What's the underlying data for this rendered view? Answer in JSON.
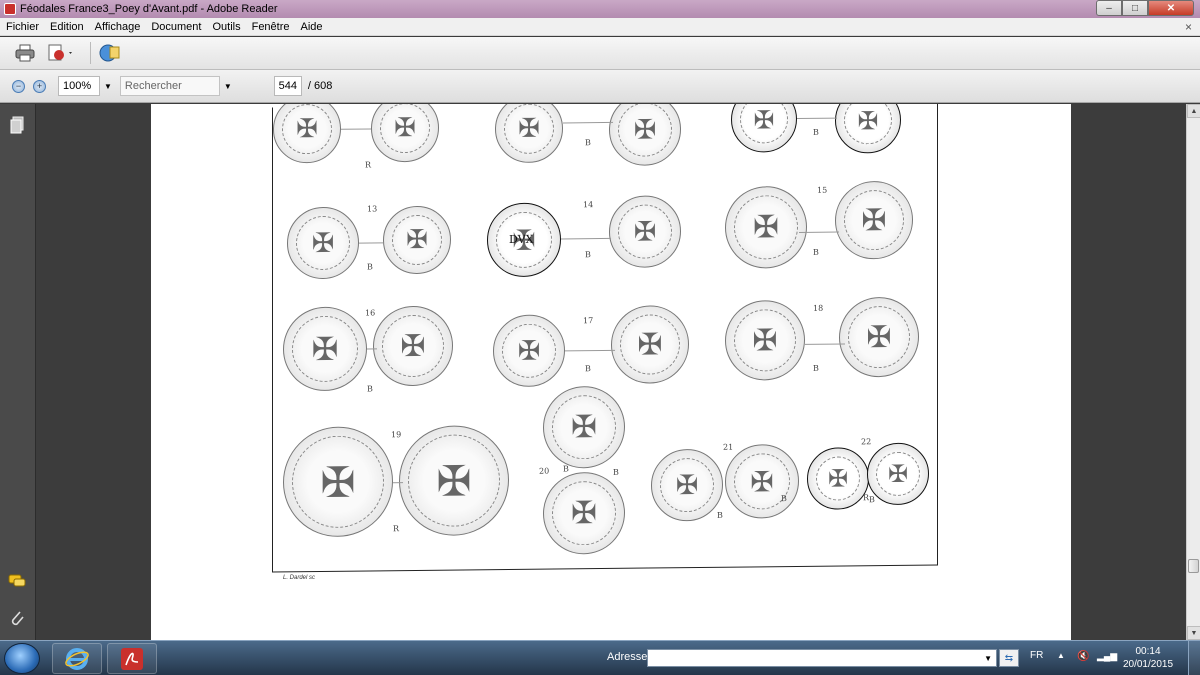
{
  "window": {
    "title": "Féodales France3_Poey d'Avant.pdf - Adobe Reader",
    "controls": {
      "minimize": "–",
      "maximize": "□",
      "close": "✕"
    }
  },
  "menu": [
    "Fichier",
    "Edition",
    "Affichage",
    "Document",
    "Outils",
    "Fenêtre",
    "Aide"
  ],
  "menu_close": "×",
  "toolbar2": {
    "zoom_value": "100%",
    "search_placeholder": "Rechercher",
    "page_current": "544",
    "page_total": "/ 608"
  },
  "plate": {
    "coin_labels": [
      "13",
      "14",
      "15",
      "16",
      "17",
      "18",
      "19",
      "20",
      "21",
      "22"
    ],
    "metal_marks": [
      "R",
      "B",
      "B",
      "B",
      "B",
      "B",
      "B",
      "B",
      "B",
      "B",
      "B",
      "R",
      "R",
      "B",
      "B",
      "B"
    ],
    "coin_legend": "DVX",
    "engraver": "L. Dardel sc"
  },
  "taskbar": {
    "address_label": "Adresse",
    "address_value": "",
    "language": "FR",
    "time": "00:14",
    "date": "20/01/2015"
  },
  "colors": {
    "title_bar": "#c9a8c6",
    "taskbar": "#24364a",
    "doc_bg": "#3c3c3c",
    "reader_red": "#c9302c"
  }
}
